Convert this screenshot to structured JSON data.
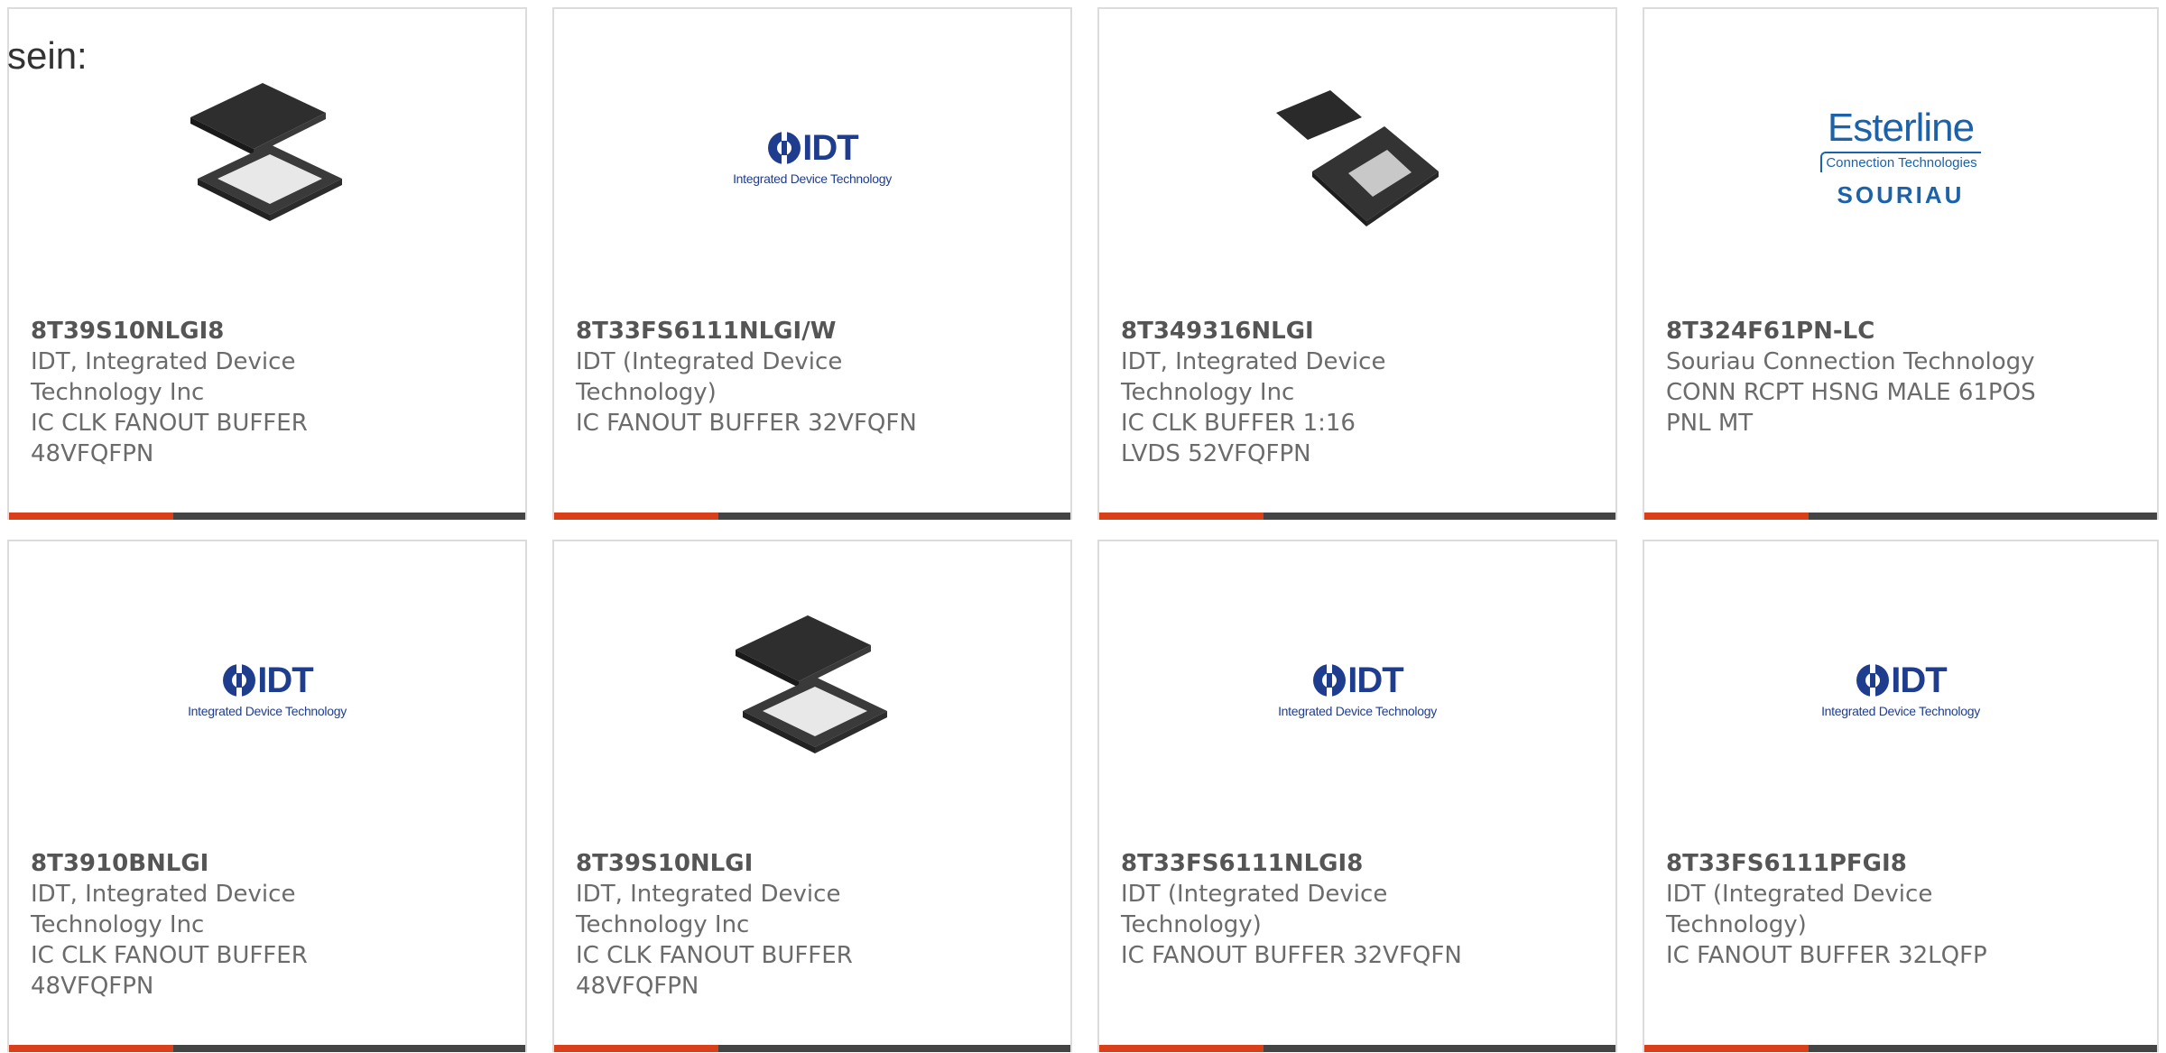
{
  "heading_fragment": "sein:",
  "colors": {
    "accent": "#d9401a",
    "bar": "#444444",
    "idt_blue": "#1f3d8f",
    "souriau_blue": "#1b62a8"
  },
  "products": [
    {
      "part_number": "8T39S10NLGI8",
      "manufacturer": "IDT, Integrated Device Technology Inc",
      "description": "IC CLK FANOUT BUFFER 48VFQFPN",
      "image": "chip-package-image"
    },
    {
      "part_number": "8T33FS6111NLGI/W",
      "manufacturer": "IDT (Integrated Device Technology)",
      "description": "IC FANOUT BUFFER 32VFQFN",
      "image": "idt-logo"
    },
    {
      "part_number": "8T349316NLGI",
      "manufacturer": "IDT, Integrated Device Technology Inc",
      "description": "IC CLK BUFFER 1:16 LVDS 52VFQFPN",
      "image": "chip-package-image"
    },
    {
      "part_number": "8T324F61PN-LC",
      "manufacturer": "Souriau Connection Technology",
      "description": "CONN RCPT HSNG MALE 61POS PNL MT",
      "image": "esterline-souriau-logo"
    },
    {
      "part_number": "8T3910BNLGI",
      "manufacturer": "IDT, Integrated Device Technology Inc",
      "description": "IC CLK FANOUT BUFFER 48VFQFPN",
      "image": "idt-logo"
    },
    {
      "part_number": "8T39S10NLGI",
      "manufacturer": "IDT, Integrated Device Technology Inc",
      "description": "IC CLK FANOUT BUFFER 48VFQFPN",
      "image": "chip-package-image"
    },
    {
      "part_number": "8T33FS6111NLGI8",
      "manufacturer": "IDT (Integrated Device Technology)",
      "description": "IC FANOUT BUFFER 32VFQFN",
      "image": "idt-logo"
    },
    {
      "part_number": "8T33FS6111PFGI8",
      "manufacturer": "IDT (Integrated Device Technology)",
      "description": "IC FANOUT BUFFER 32LQFP",
      "image": "idt-logo"
    }
  ],
  "logos": {
    "idt": {
      "word": "IDT",
      "subtitle": "Integrated Device Technology"
    },
    "esterline": {
      "word": "Esterline",
      "subtitle": "Connection Technologies",
      "brand": "SOURIAU"
    }
  }
}
